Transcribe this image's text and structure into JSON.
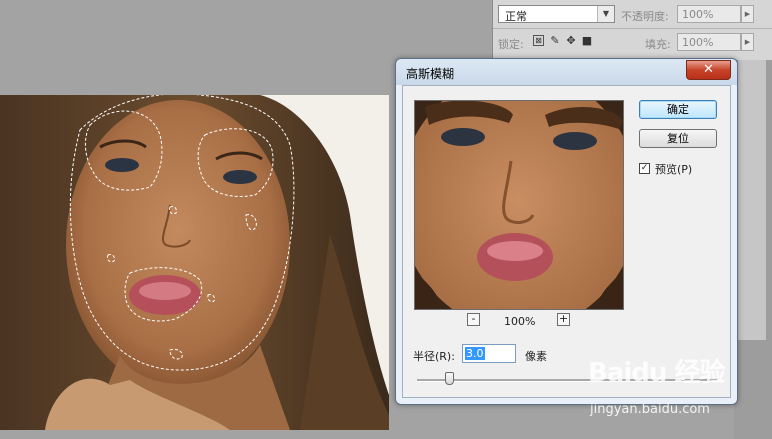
{
  "layers_panel": {
    "blend_mode": "正常",
    "opacity_label": "不透明度:",
    "opacity_value": "100%",
    "lock_label": "锁定:",
    "fill_label": "填充:",
    "fill_value": "100%",
    "lock_icons": [
      "lock-transparent-pixels-icon",
      "lock-image-pixels-icon",
      "lock-position-icon",
      "lock-all-icon"
    ]
  },
  "dialog": {
    "title": "高斯模糊",
    "close_glyph": "✕",
    "ok_label": "确定",
    "reset_label": "复位",
    "preview_checked": true,
    "preview_label": "预览(P)",
    "zoom_out_glyph": "-",
    "zoom_in_glyph": "+",
    "zoom_value": "100%",
    "radius_label": "半径(R):",
    "radius_value": "3.0",
    "radius_unit": "像素"
  },
  "watermark": {
    "logo": "Baidu 经验",
    "url": "jingyan.baidu.com"
  },
  "colors": {
    "dialog_bg": "#eaf0f7",
    "close_red": "#c7432a",
    "default_button": "#bee6fd",
    "workspace": "#a3a3a3"
  }
}
